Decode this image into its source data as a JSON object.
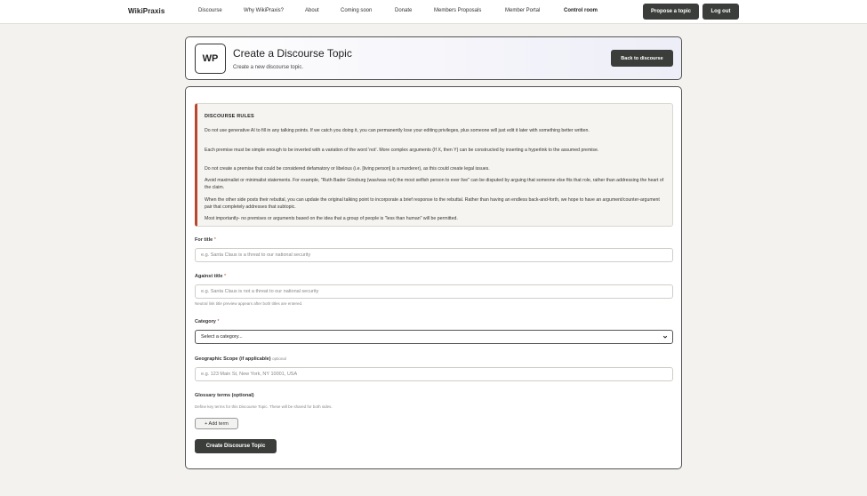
{
  "nav": {
    "brand": "WikiPraxis",
    "links": [
      "Discourse",
      "Why WikiPraxis?",
      "About",
      "Coming soon",
      "Donate",
      "Members Proposals",
      "Member Portal",
      "Control room"
    ],
    "propose_label": "Propose a topic",
    "logout_label": "Log out"
  },
  "header": {
    "logo_text": "WP",
    "title": "Create a Discourse Topic",
    "subtitle": "Create a new discourse topic.",
    "back_label": "Back to discourse"
  },
  "rules": {
    "title": "DISCOURSE RULES",
    "items": [
      "Do not use generative AI to fill in any talking points. If we catch you doing it, you can permanently lose your editing privileges, plus someone will just edit it later with something better written.",
      "Each premise must be simple enough to be inverted with a variation of the word 'not'. More complex arguments (If X, then Y) can be constructed by inserting a hyperlink to the assumed premise.",
      "Do not create a premise that could be considered defamatory or libelous (i.e. [living person] is a murderer), as this could create legal issues.",
      "Avoid maximalist or minimalist statements. For example, \"Ruth Bader Ginsburg (was/was not) the most selfish person to ever live\" can be disputed by arguing that someone else fits that role, rather than addressing the heart of the claim.",
      "When the other side posts their rebuttal, you can update the original talking point to incorporate a brief response to the rebuttal. Rather than having an endless back-and-forth, we hope to have an argument/counter-argument pair that completely addresses that subtopic.",
      "Most importantly- no premises or arguments based on the idea that a group of people is \"less than human\" will be permitted."
    ]
  },
  "form": {
    "for_title": {
      "label": "For title",
      "required": "*",
      "placeholder": "e.g. Santa Claus is a threat to our national security",
      "value": ""
    },
    "against_title": {
      "label": "Against title",
      "required": "*",
      "placeholder": "e.g. Santa Claus is not a threat to our national security",
      "value": "",
      "hint": "Neutral link title preview appears after both titles are entered."
    },
    "category": {
      "label": "Category",
      "required": "*",
      "selected": "Select a category..."
    },
    "geo_scope": {
      "label": "Geographic Scope (if applicable)",
      "optional": "optional",
      "placeholder": "e.g. 123 Main St, New York, NY 10001, USA",
      "value": ""
    },
    "glossary": {
      "label": "Glossary terms (optional)",
      "hint": "Define key terms for this Discourse Topic. These will be shared for both sides.",
      "add_label": "+ Add term"
    },
    "submit_label": "Create Discourse Topic"
  },
  "colors": {
    "accent": "#b8472e",
    "button_dark": "#3b3d3b",
    "background": "#f3f2ee"
  }
}
